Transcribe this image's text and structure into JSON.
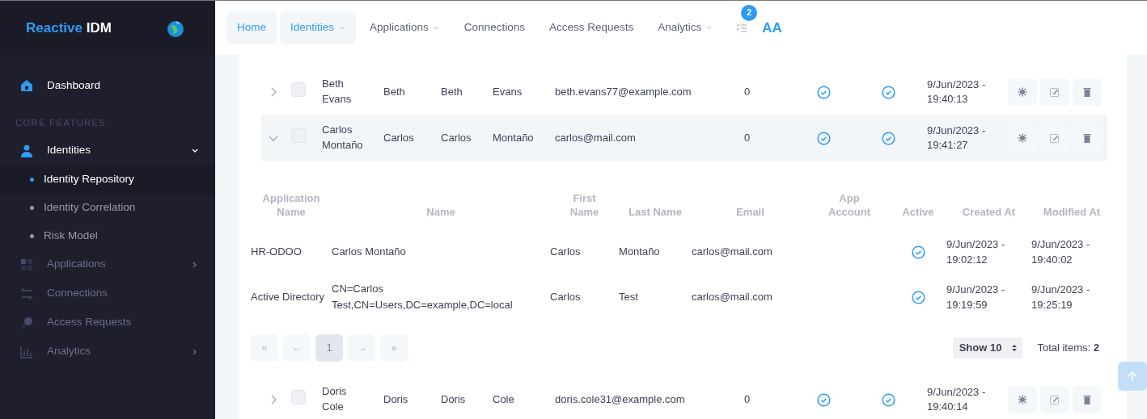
{
  "sidebar": {
    "brand_primary": "Reactive",
    "brand_secondary": "IDM",
    "items": [
      {
        "kind": "item",
        "label": "Dashboard",
        "highlighted": true
      },
      {
        "kind": "section",
        "label": "CORE FEATURES"
      },
      {
        "kind": "item",
        "label": "Identities",
        "highlighted": true,
        "expanded": true,
        "children": [
          {
            "label": "Identity Repository",
            "selected": true
          },
          {
            "label": "Identity Correlation",
            "selected": false
          },
          {
            "label": "Risk Model",
            "selected": false
          }
        ]
      },
      {
        "kind": "item",
        "label": "Applications",
        "highlighted": false,
        "expanded": false
      },
      {
        "kind": "item",
        "label": "Connections",
        "highlighted": false
      },
      {
        "kind": "item",
        "label": "Access Requests",
        "highlighted": false
      },
      {
        "kind": "item",
        "label": "Analytics",
        "highlighted": false,
        "expanded": false
      }
    ]
  },
  "topbar": {
    "nav": [
      {
        "label": "Home",
        "active": true,
        "dropdown": false
      },
      {
        "label": "Identities",
        "active": true,
        "dropdown": true
      },
      {
        "label": "Applications",
        "active": false,
        "dropdown": true
      },
      {
        "label": "Connections",
        "active": false,
        "dropdown": false
      },
      {
        "label": "Access Requests",
        "active": false,
        "dropdown": false
      },
      {
        "label": "Analytics",
        "active": false,
        "dropdown": true
      }
    ],
    "tasks_badge": "2",
    "font_toggle": "AA"
  },
  "identities": [
    {
      "name": "Beth Evans",
      "given_name": "Beth",
      "first_name": "Beth",
      "last_name": "Evans",
      "email": "beth.evans77@example.com",
      "count": "0",
      "check_1": true,
      "check_2": true,
      "created": "9/Jun/2023 - 19:40:13",
      "checked": false,
      "expanded": false
    },
    {
      "name": "Carlos Montaño",
      "given_name": "Carlos",
      "first_name": "Carlos",
      "last_name": "Montaño",
      "email": "carlos@mail.com",
      "count": "0",
      "check_1": true,
      "check_2": true,
      "created": "9/Jun/2023 - 19:41:27",
      "checked": false,
      "expanded": true,
      "details": {
        "columns": [
          "Application Name",
          "Name",
          "First Name",
          "Last Name",
          "Email",
          "App Account",
          "Active",
          "Created At",
          "Modified At"
        ],
        "rows": [
          {
            "application_name": "HR-ODOO",
            "name": "Carlos Montaño",
            "first_name": "Carlos",
            "last_name": "Montaño",
            "email": "carlos@mail.com",
            "active": true,
            "created_at": "9/Jun/2023 - 19:02:12",
            "modified_at": "9/Jun/2023 - 19:40:02"
          },
          {
            "application_name": "Active Directory",
            "name": "CN=Carlos Test,CN=Users,DC=example,DC=local",
            "first_name": "Carlos",
            "last_name": "Test",
            "email": "carlos@mail.com",
            "active": true,
            "created_at": "9/Jun/2023 - 19:19:59",
            "modified_at": "9/Jun/2023 - 19:25:19"
          }
        ],
        "pagination": [
          {
            "label": "«",
            "selected": false
          },
          {
            "label": "←",
            "selected": false
          },
          {
            "label": "1",
            "selected": true
          },
          {
            "label": "→",
            "selected": false
          },
          {
            "label": "»",
            "selected": false
          }
        ],
        "page_size": "Show 10",
        "total": "Total items: **2**"
      }
    },
    {
      "name": "Doris Cole",
      "given_name": "Doris",
      "first_name": "Doris",
      "last_name": "Cole",
      "email": "doris.cole31@example.com",
      "count": "0",
      "check_1": true,
      "check_2": true,
      "created": "9/Jun/2023 - 19:40:14",
      "checked": false,
      "expanded": false
    }
  ]
}
